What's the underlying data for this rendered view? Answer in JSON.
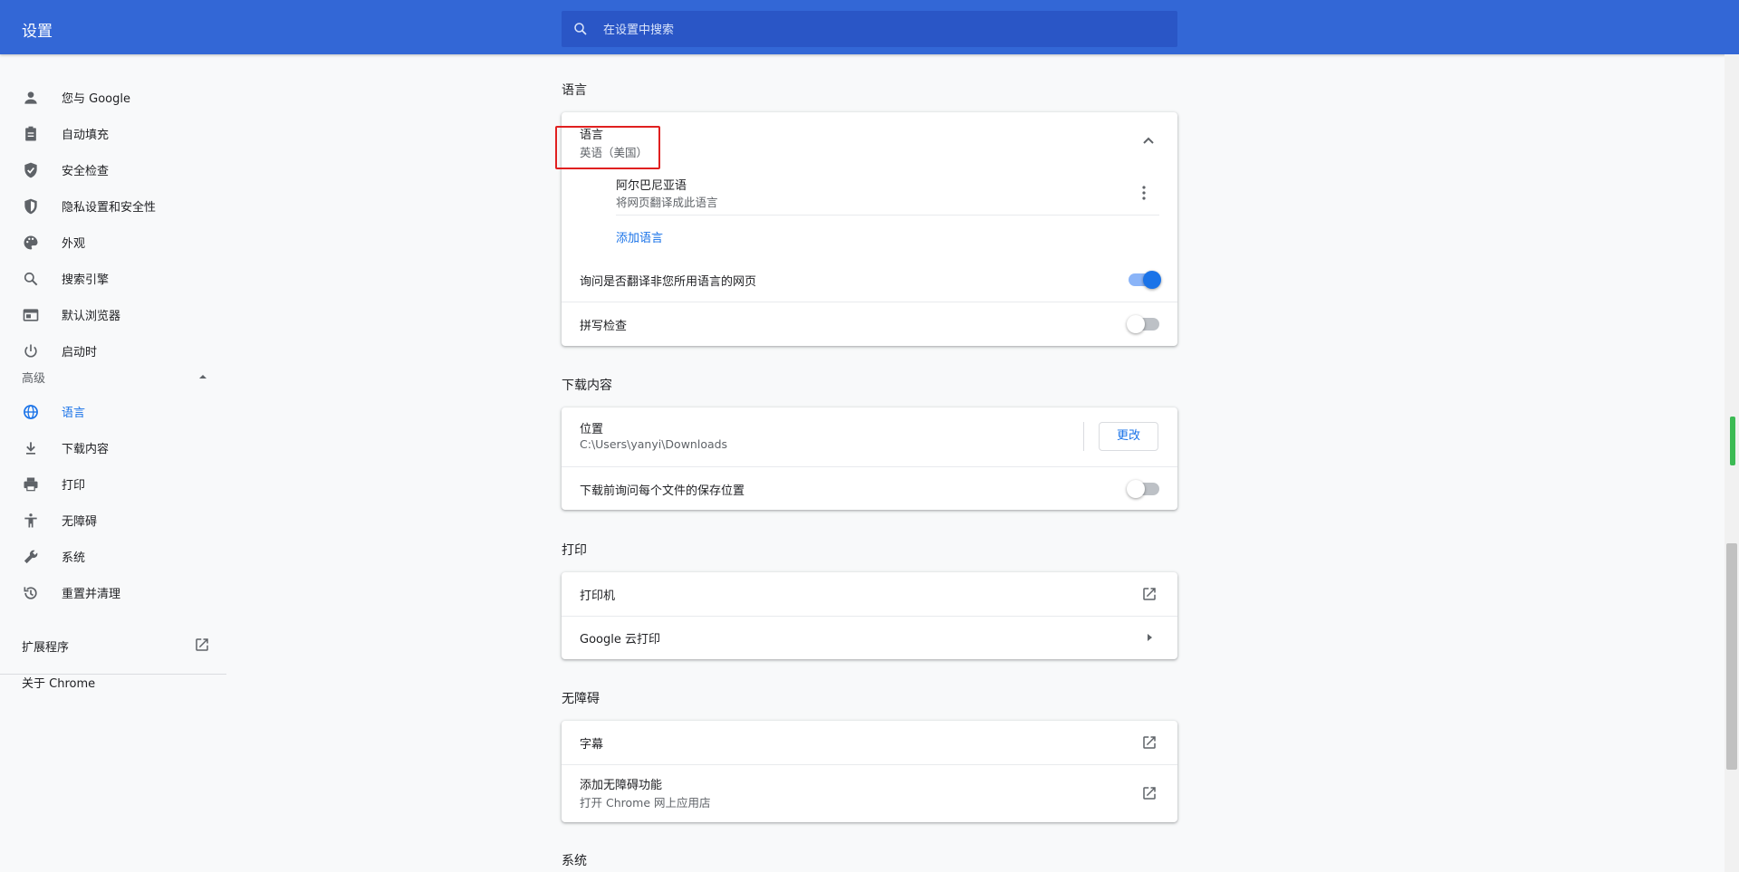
{
  "header": {
    "title": "设置",
    "search_placeholder": "在设置中搜索"
  },
  "sidebar": {
    "items": [
      {
        "label": "您与 Google",
        "icon": "person-icon"
      },
      {
        "label": "自动填充",
        "icon": "clipboard-icon"
      },
      {
        "label": "安全检查",
        "icon": "shield-check-icon"
      },
      {
        "label": "隐私设置和安全性",
        "icon": "shield-half-icon"
      },
      {
        "label": "外观",
        "icon": "palette-icon"
      },
      {
        "label": "搜索引擎",
        "icon": "search-icon"
      },
      {
        "label": "默认浏览器",
        "icon": "browser-icon"
      },
      {
        "label": "启动时",
        "icon": "power-icon"
      }
    ],
    "advanced_label": "高级",
    "advanced_items": [
      {
        "label": "语言",
        "icon": "globe-icon",
        "active": true
      },
      {
        "label": "下载内容",
        "icon": "download-icon"
      },
      {
        "label": "打印",
        "icon": "printer-icon"
      },
      {
        "label": "无障碍",
        "icon": "accessibility-icon"
      },
      {
        "label": "系统",
        "icon": "wrench-icon"
      },
      {
        "label": "重置并清理",
        "icon": "history-icon"
      }
    ],
    "extensions_label": "扩展程序",
    "about_label": "关于 Chrome"
  },
  "languages": {
    "section_title": "语言",
    "lang_title": "语言",
    "lang_value": "英语（美国）",
    "lang_entry_name": "阿尔巴尼亚语",
    "lang_entry_sub": "将网页翻译成此语言",
    "add_language": "添加语言",
    "offer_translate": "询问是否翻译非您所用语言的网页",
    "offer_translate_on": true,
    "spellcheck": "拼写检查",
    "spellcheck_on": false
  },
  "downloads": {
    "section_title": "下载内容",
    "location_label": "位置",
    "location_value": "C:\\Users\\yanyi\\Downloads",
    "change_button": "更改",
    "ask_where": "下载前询问每个文件的保存位置",
    "ask_where_on": false
  },
  "printing": {
    "section_title": "打印",
    "printers": "打印机",
    "cloud_print": "Google 云打印"
  },
  "accessibility": {
    "section_title": "无障碍",
    "captions": "字幕",
    "add_features": "添加无障碍功能",
    "add_features_sub": "打开 Chrome 网上应用店"
  },
  "system": {
    "section_title": "系统"
  }
}
